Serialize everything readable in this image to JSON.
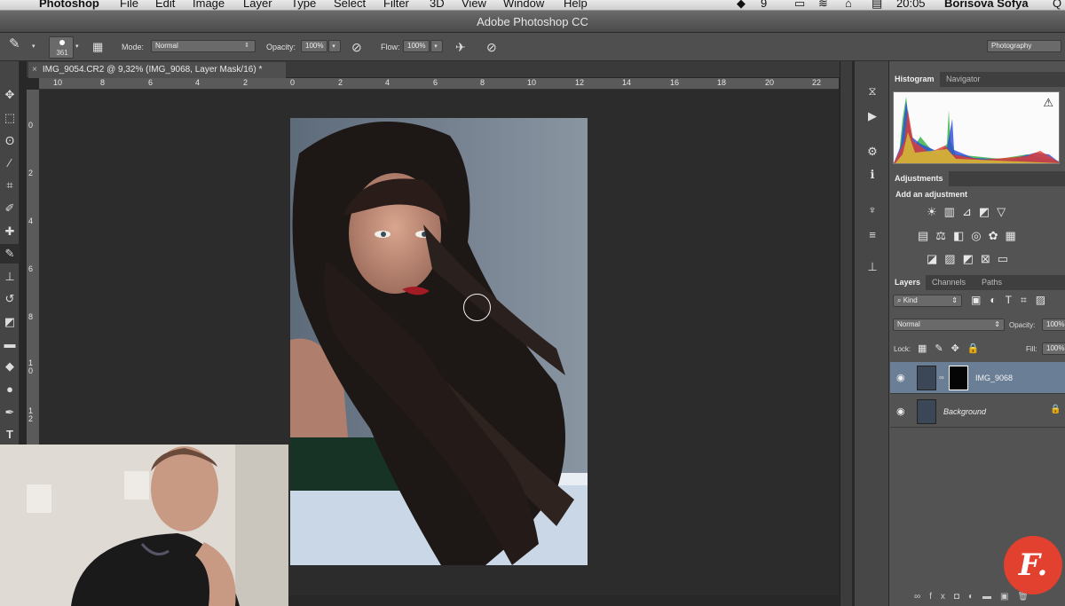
{
  "menubar": {
    "items": [
      "Photoshop",
      "File",
      "Edit",
      "Image",
      "Layer",
      "Type",
      "Select",
      "Filter",
      "3D",
      "View",
      "Window",
      "Help"
    ],
    "status_count": "9",
    "time": "20:05",
    "user": "Borisova Sofya"
  },
  "window": {
    "title": "Adobe Photoshop CC"
  },
  "options": {
    "brush_size": "361",
    "mode_label": "Mode:",
    "mode_value": "Normal",
    "opacity_label": "Opacity:",
    "opacity_value": "100%",
    "flow_label": "Flow:",
    "flow_value": "100%",
    "workspace": "Photography"
  },
  "document": {
    "tab_title": "IMG_9054.CR2 @ 9,32% (IMG_9068, Layer Mask/16) *",
    "close_glyph": "×"
  },
  "ruler": {
    "h_ticks": [
      "10",
      "8",
      "6",
      "4",
      "2",
      "0",
      "2",
      "4",
      "6",
      "8",
      "10",
      "12",
      "14",
      "16",
      "18",
      "20",
      "22"
    ],
    "v_ticks": [
      "0",
      "2",
      "4",
      "6",
      "8",
      "1\n0",
      "1\n2"
    ]
  },
  "panels": {
    "histogram_tabs": [
      "Histogram",
      "Navigator"
    ],
    "adjustments_tab": "Adjustments",
    "adjustments_subtitle": "Add an adjustment",
    "layers_tabs": [
      "Layers",
      "Channels",
      "Paths"
    ],
    "filter_kind": "Kind",
    "blend_mode": "Normal",
    "opacity_label": "Opacity:",
    "opacity_value": "100%",
    "lock_label": "Lock:",
    "fill_label": "Fill:",
    "fill_value": "100%",
    "layers": [
      {
        "name": "IMG_9068",
        "selected": true
      },
      {
        "name": "Background",
        "selected": false
      }
    ]
  },
  "logo": {
    "text": "F."
  },
  "colors": {
    "accent": "#e2412f",
    "panel": "#535353",
    "selected_layer": "#6a7e96"
  }
}
